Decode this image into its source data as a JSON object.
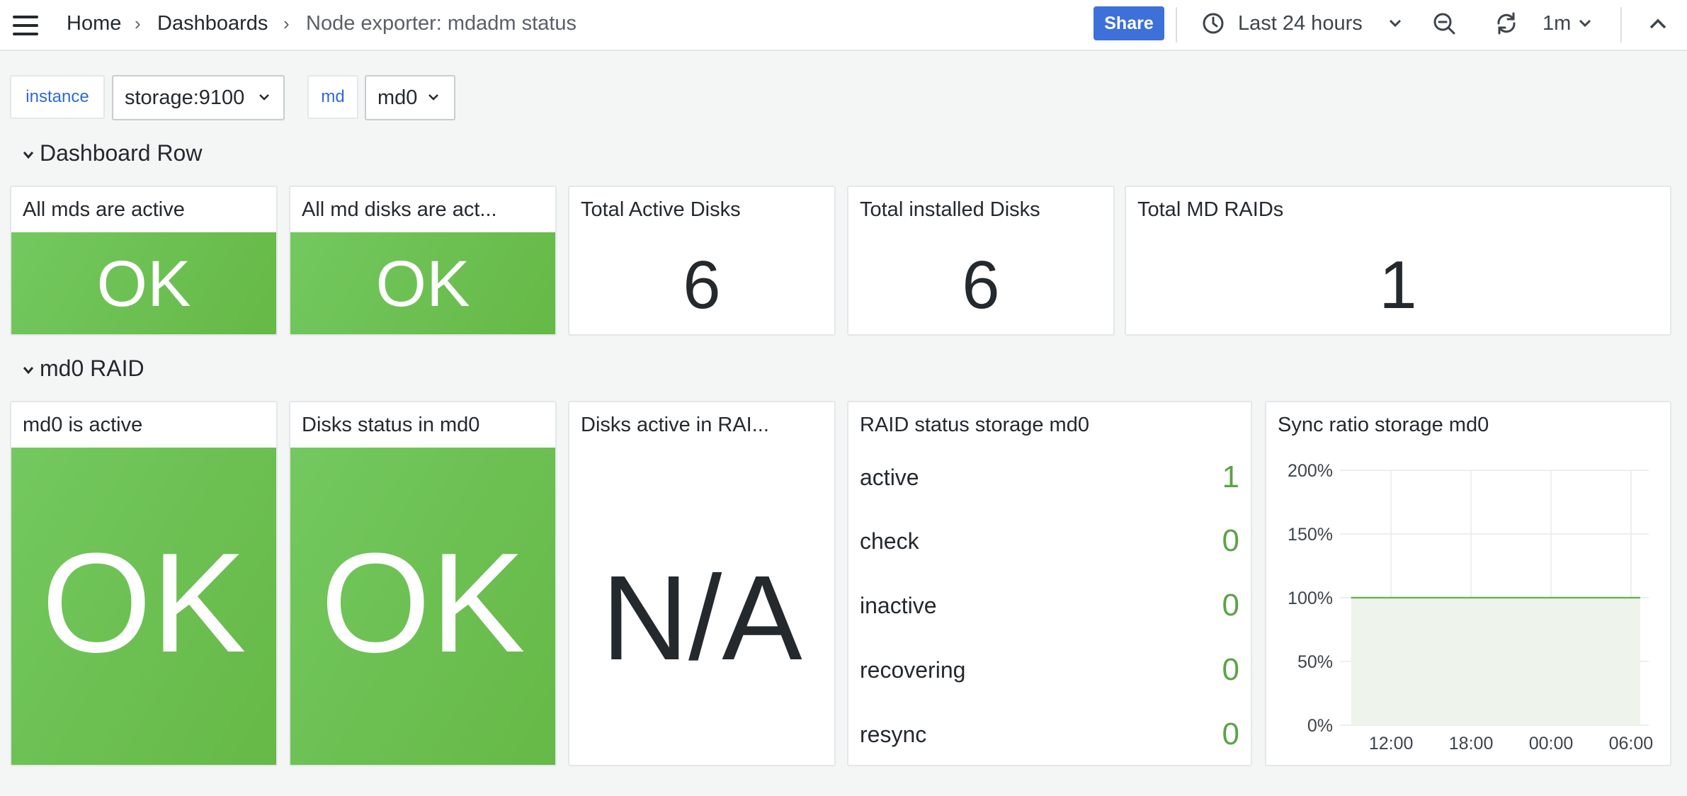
{
  "breadcrumb": {
    "home": "Home",
    "dashboards": "Dashboards",
    "current": "Node exporter: mdadm status",
    "separator": "›"
  },
  "toolbar": {
    "share_label": "Share",
    "time_range": "Last 24 hours",
    "refresh_interval": "1m"
  },
  "icons": {
    "menu": "hamburger-icon",
    "clock": "clock-icon",
    "zoom_out": "zoom-out-icon",
    "refresh": "refresh-icon",
    "collapse": "chevron-up-icon",
    "dropdown": "chevron-down-icon"
  },
  "variables": [
    {
      "label": "instance",
      "value": "storage:9100"
    },
    {
      "label": "md",
      "value": "md0"
    }
  ],
  "rows": [
    {
      "title": "Dashboard Row",
      "panels": [
        {
          "title": "All mds are active",
          "value": "OK",
          "color": "#6cc25a"
        },
        {
          "title": "All md disks are act...",
          "value": "OK",
          "color": "#6cc25a"
        },
        {
          "title": "Total Active Disks",
          "value": "6"
        },
        {
          "title": "Total installed Disks",
          "value": "6"
        },
        {
          "title": "Total MD RAIDs",
          "value": "1"
        }
      ]
    },
    {
      "title": "md0 RAID",
      "panels": [
        {
          "title": "md0 is active",
          "value": "OK",
          "color": "#6cc25a"
        },
        {
          "title": "Disks status in md0",
          "value": "OK",
          "color": "#6cc25a"
        },
        {
          "title": "Disks active in RAI...",
          "value": "N/A"
        },
        {
          "title": "RAID status storage md0",
          "items": [
            {
              "label": "active",
              "value": "1"
            },
            {
              "label": "check",
              "value": "0"
            },
            {
              "label": "inactive",
              "value": "0"
            },
            {
              "label": "recovering",
              "value": "0"
            },
            {
              "label": "resync",
              "value": "0"
            }
          ],
          "value_color": "#5ca34a"
        },
        {
          "title": "Sync ratio storage md0"
        }
      ]
    }
  ],
  "chart_data": {
    "type": "area",
    "title": "Sync ratio storage md0",
    "x": [
      "09:00",
      "12:00",
      "15:00",
      "18:00",
      "21:00",
      "00:00",
      "03:00",
      "06:00",
      "07:00"
    ],
    "series": [
      {
        "values": [
          100,
          100,
          100,
          100,
          100,
          100,
          100,
          100,
          100
        ],
        "color": "#6cc25a"
      }
    ],
    "y_ticks": [
      "0%",
      "50%",
      "100%",
      "150%",
      "200%"
    ],
    "x_ticks": [
      "12:00",
      "18:00",
      "00:00",
      "06:00"
    ],
    "ylim": [
      0,
      200
    ],
    "grid": true
  }
}
